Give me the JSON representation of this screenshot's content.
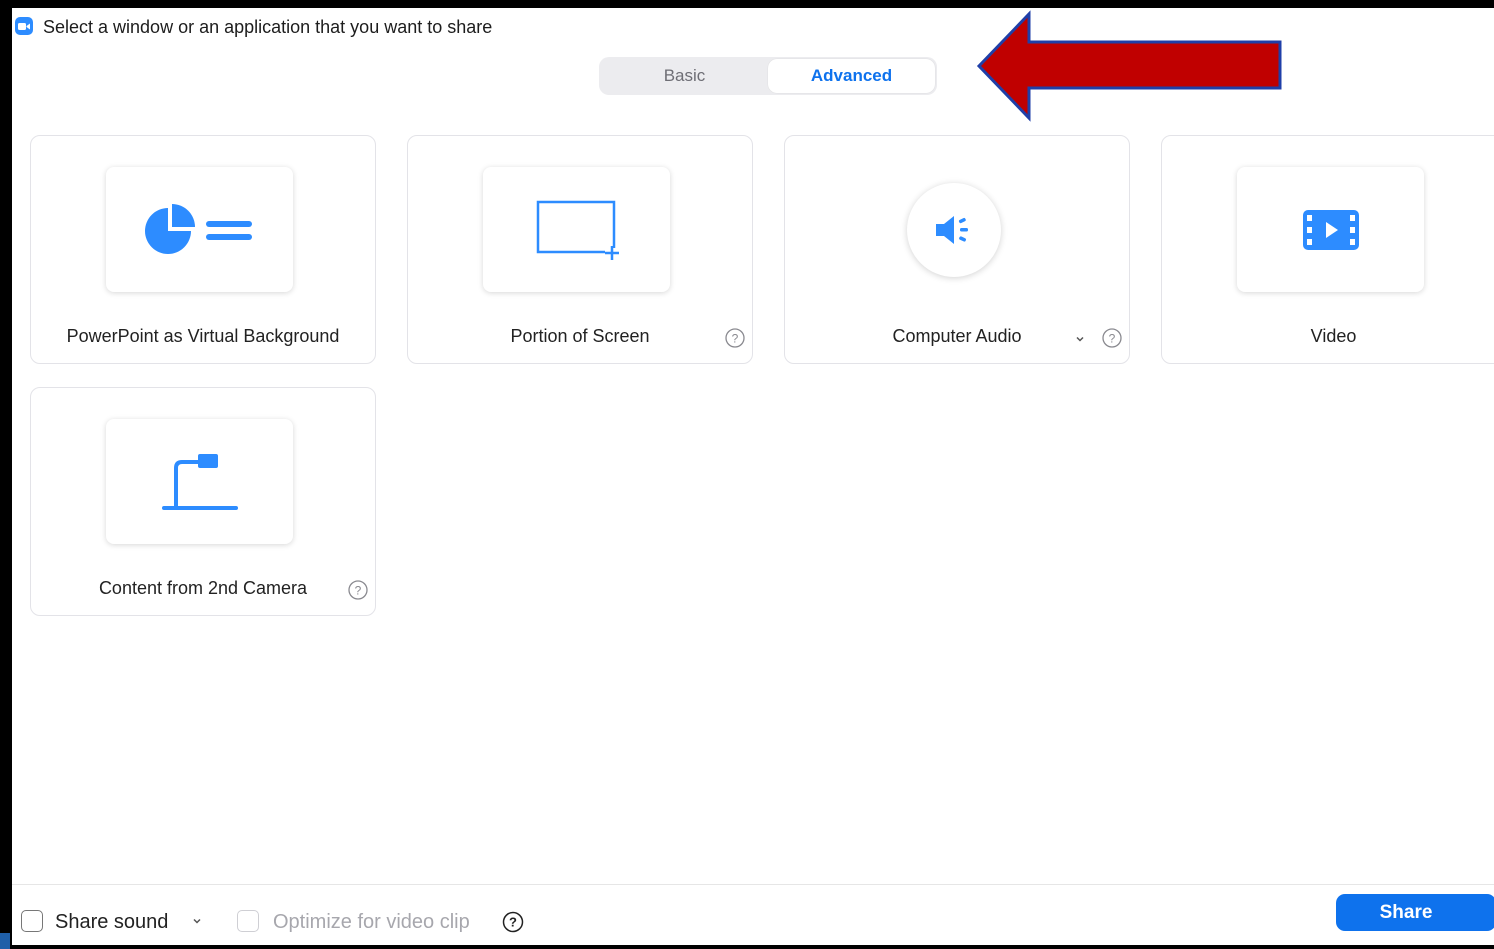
{
  "window": {
    "title": "Select a window or an application that you want to share",
    "app_icon": "zoom-camera-icon"
  },
  "tabs": {
    "basic_label": "Basic",
    "advanced_label": "Advanced",
    "selected": "Advanced"
  },
  "annotation": {
    "arrow_color": "#c00000",
    "arrow_outline": "#1f3fa8"
  },
  "options": [
    {
      "label": "PowerPoint as Virtual Background",
      "icon": "powerpoint-background-icon",
      "help": false,
      "dropdown": false
    },
    {
      "label": "Portion of Screen",
      "icon": "portion-of-screen-icon",
      "help": true,
      "dropdown": false
    },
    {
      "label": "Computer Audio",
      "icon": "speaker-icon",
      "help": true,
      "dropdown": true
    },
    {
      "label": "Video",
      "icon": "video-film-icon",
      "help": false,
      "dropdown": false
    },
    {
      "label": "Content from 2nd Camera",
      "icon": "document-camera-icon",
      "help": true,
      "dropdown": false
    }
  ],
  "footer": {
    "share_sound_label": "Share sound",
    "share_sound_checked": false,
    "optimize_label": "Optimize for video clip",
    "optimize_checked": false,
    "optimize_disabled": true,
    "share_button_label": "Share"
  },
  "colors": {
    "accent": "#0e72ed",
    "icon_blue": "#2d8cff",
    "tab_background": "#ececef"
  }
}
